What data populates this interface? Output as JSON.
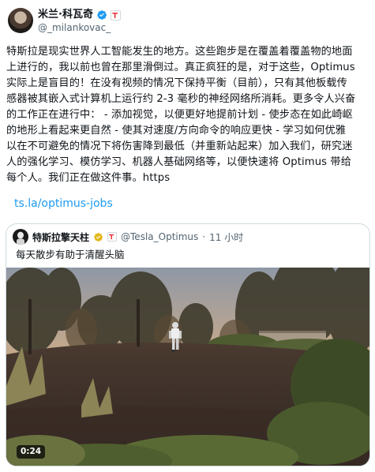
{
  "author": {
    "display_name": "米兰·科瓦奇",
    "handle": "@_milankovac_"
  },
  "post": {
    "lines": [
      "特斯拉是现实世界人工智能发生的地方。这些跑步是在覆盖着覆盖物的地面",
      "上进行的，我以前也曾在那里滑倒过。真正疯狂的是，对于这些，Optimus",
      "实际上是盲目的！在没有视频的情况下保持平衡（目前），只有其他板载传",
      "感器被其嵌入式计算机上运行约 2-3 毫秒的神经网络所消耗。更多令人兴奋",
      "的工作正在进行中： - 添加视觉，以便更好地提前计划 - 使步态在如此崎岖",
      "的地形上看起来更自然 - 使其对速度/方向命令的响应更快 - 学习如何优雅",
      "以在不可避免的情况下将伤害降到最低（并重新站起来）加入我们，研究迷",
      "人的强化学习、模仿学习、机器人基础网络等，以便快速将 Optimus 带给",
      "每个人。我们正在做这件事。https"
    ],
    "link": "ts.la/optimus-jobs"
  },
  "quoted": {
    "display_name": "特斯拉擎天柱",
    "handle": "@Tesla_Optimus",
    "separator": "·",
    "time": "11 小时",
    "text": "每天散步有助于清醒头脑",
    "video_duration": "0:24"
  },
  "colors": {
    "link": "#1d9bf0",
    "verified_blue": "#1d9bf0",
    "verified_gold": "#e2b719",
    "tesla_red": "#e82127"
  },
  "icons": {
    "verified": "verified-badge-icon",
    "affiliate": "tesla-affiliate-icon"
  }
}
